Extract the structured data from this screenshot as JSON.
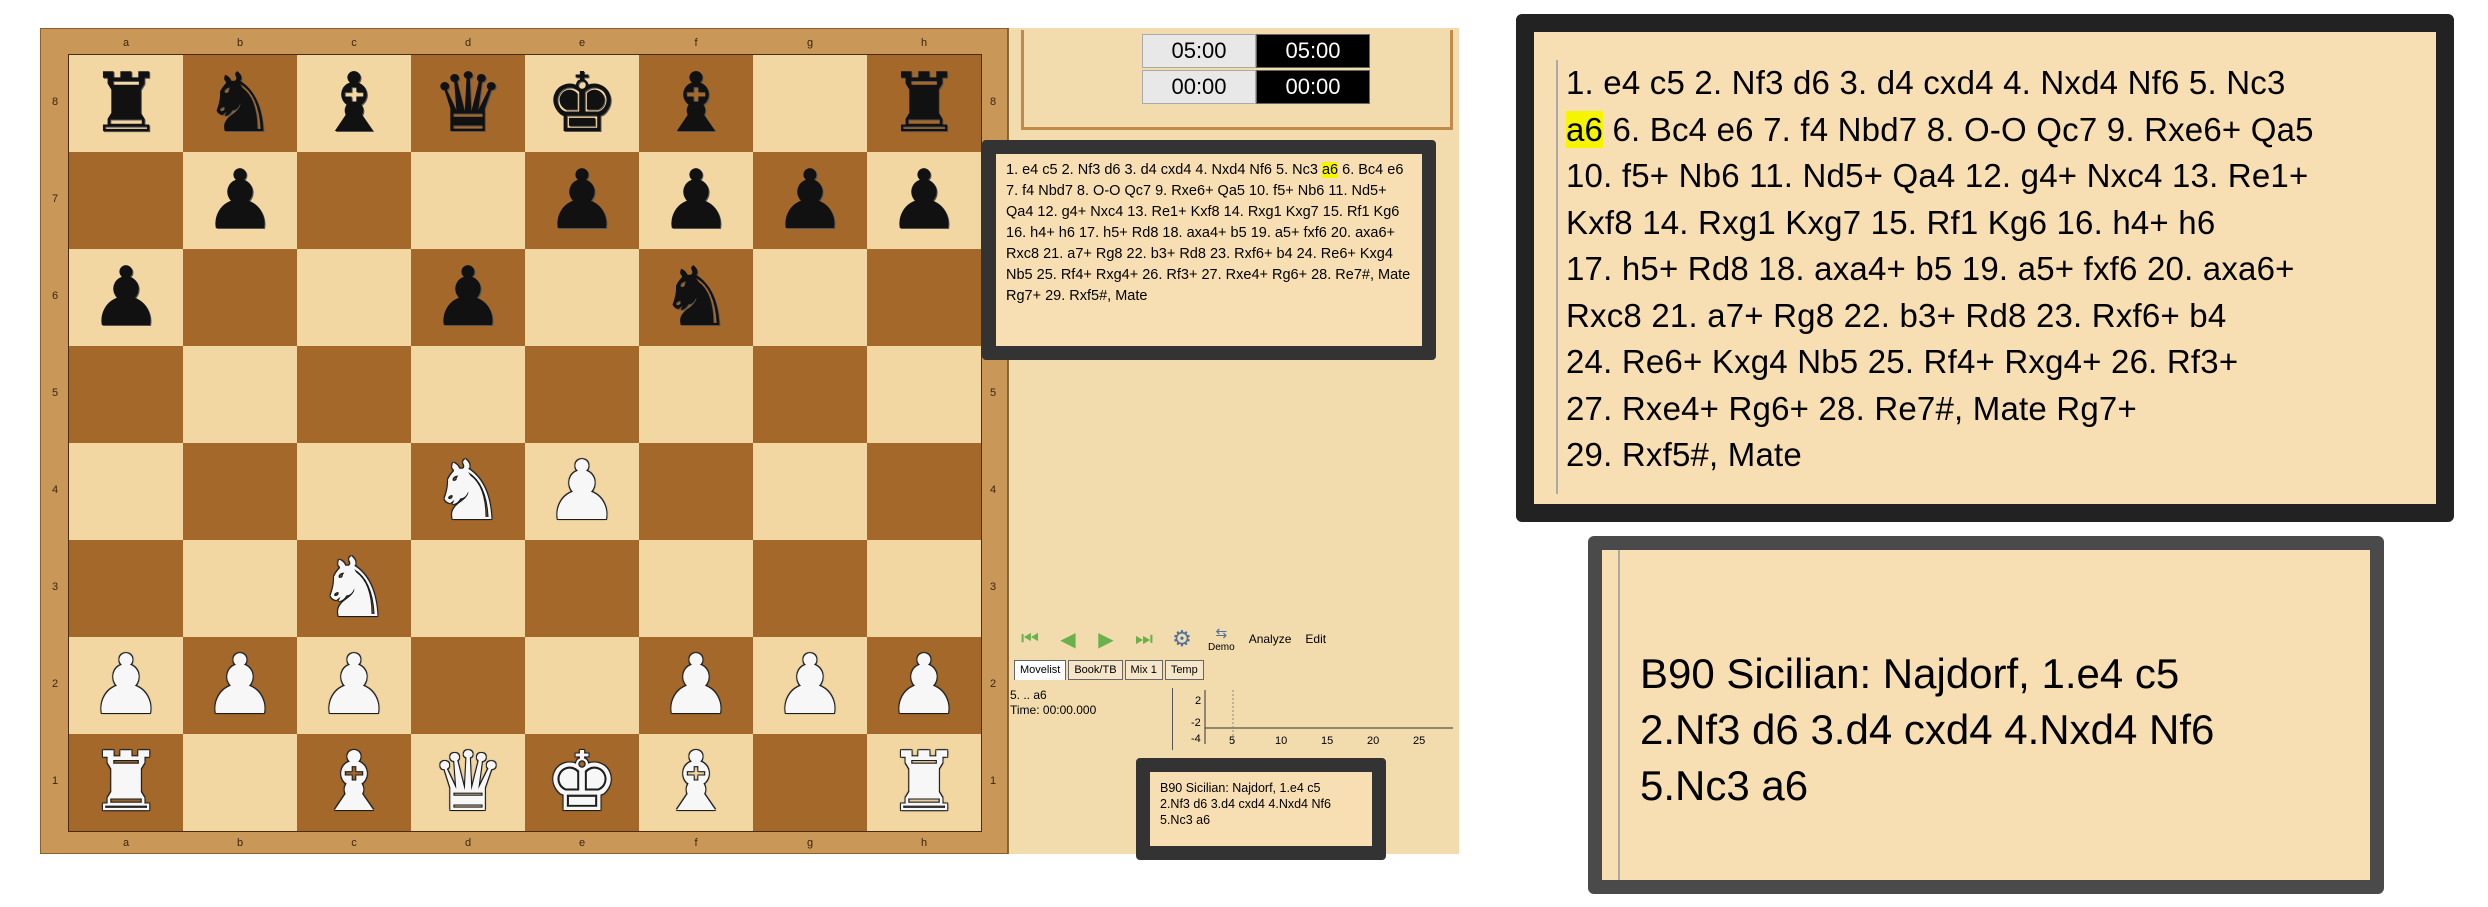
{
  "board": {
    "files": [
      "a",
      "b",
      "c",
      "d",
      "e",
      "f",
      "g",
      "h"
    ],
    "ranks": [
      "8",
      "7",
      "6",
      "5",
      "4",
      "3",
      "2",
      "1"
    ],
    "rows": [
      [
        "br",
        "bn",
        "bb",
        "bq",
        "bk",
        "bb",
        "",
        "br"
      ],
      [
        "",
        "bp",
        "",
        "",
        "bp",
        "bp",
        "bp",
        "bp"
      ],
      [
        "bp",
        "",
        "",
        "bp",
        "",
        "bn",
        "",
        ""
      ],
      [
        "",
        "",
        "",
        "",
        "",
        "",
        "",
        ""
      ],
      [
        "",
        "",
        "",
        "wn",
        "wp",
        "",
        "",
        ""
      ],
      [
        "",
        "",
        "wn",
        "",
        "",
        "",
        "",
        ""
      ],
      [
        "wp",
        "wp",
        "wp",
        "",
        "",
        "wp",
        "wp",
        "wp"
      ],
      [
        "wr",
        "",
        "wb",
        "wq",
        "wk",
        "wb",
        "",
        "wr"
      ]
    ]
  },
  "clocks": {
    "top_white": "05:00",
    "top_black": "05:00",
    "bottom_white": "00:00",
    "bottom_black": "00:00"
  },
  "movelist": {
    "before_highlight": "1. e4 c5 2. Nf3 d6 3. d4 cxd4 4. Nxd4 Nf6 5. Nc3 ",
    "highlight": "a6",
    "after_highlight": " 6. Bc4 e6 7. f4 Nbd7 8. O-O Qc7 9. Rxe6+ Qa5 10. f5+ Nb6 11. Nd5+ Qa4 12. g4+ Nxc4 13. Re1+ Kxf8 14. Rxg1 Kxg7 15. Rf1 Kg6 16. h4+ h6 17. h5+ Rd8 18. axa4+ b5 19. a5+ fxf6 20. axa6+ Rxc8 21. a7+ Rg8 22. b3+ Rd8 23. Rxf6+ b4 24. Re6+ Kxg4 Nb5 25. Rf4+ Rxg4+ 26. Rf3+ 27. Rxe4+ Rg6+ 28. Re7#, Mate Rg7+ 29. Rxf5#, Mate",
    "zoom_lines": [
      "1. e4 c5 2. Nf3 d6 3. d4 cxd4 4. Nxd4 Nf6 5. Nc3",
      " 6. Bc4 e6 7. f4 Nbd7 8. O-O Qc7 9. Rxe6+ Qa5",
      "10. f5+ Nb6 11. Nd5+ Qa4 12. g4+ Nxc4 13. Re1+",
      "Kxf8 14. Rxg1 Kxg7 15. Rf1 Kg6 16. h4+ h6",
      "17. h5+ Rd8 18. axa4+ b5 19. a5+ fxf6 20. axa6+",
      "Rxc8 21. a7+ Rg8 22. b3+ Rd8 23. Rxf6+ b4",
      "24. Re6+ Kxg4 Nb5 25. Rf4+ Rxg4+ 26. Rf3+",
      "27. Rxe4+ Rg6+ 28. Re7#, Mate Rg7+",
      "29. Rxf5#, Mate"
    ]
  },
  "toolbar": {
    "demo_label": "Demo",
    "analyze_label": "Analyze",
    "edit_label": "Edit"
  },
  "tabs": [
    "Movelist",
    "Book/TB",
    "Mix 1",
    "Temp"
  ],
  "info": {
    "move": "5. .. a6",
    "time": "Time: 00:00.000"
  },
  "graph": {
    "y_ticks": [
      "2",
      "-2",
      "-4"
    ],
    "x_ticks": [
      "5",
      "10",
      "15",
      "20",
      "25"
    ]
  },
  "eco": {
    "lines": [
      "B90  Sicilian: Najdorf, 1.e4 c5",
      "2.Nf3 d6 3.d4 cxd4 4.Nxd4 Nf6",
      "5.Nc3 a6"
    ]
  },
  "colors": {
    "light_square": "#f3d7a3",
    "dark_square": "#a4682a",
    "highlight": "#f5f500",
    "panel_bg": "#f7dfb3"
  }
}
